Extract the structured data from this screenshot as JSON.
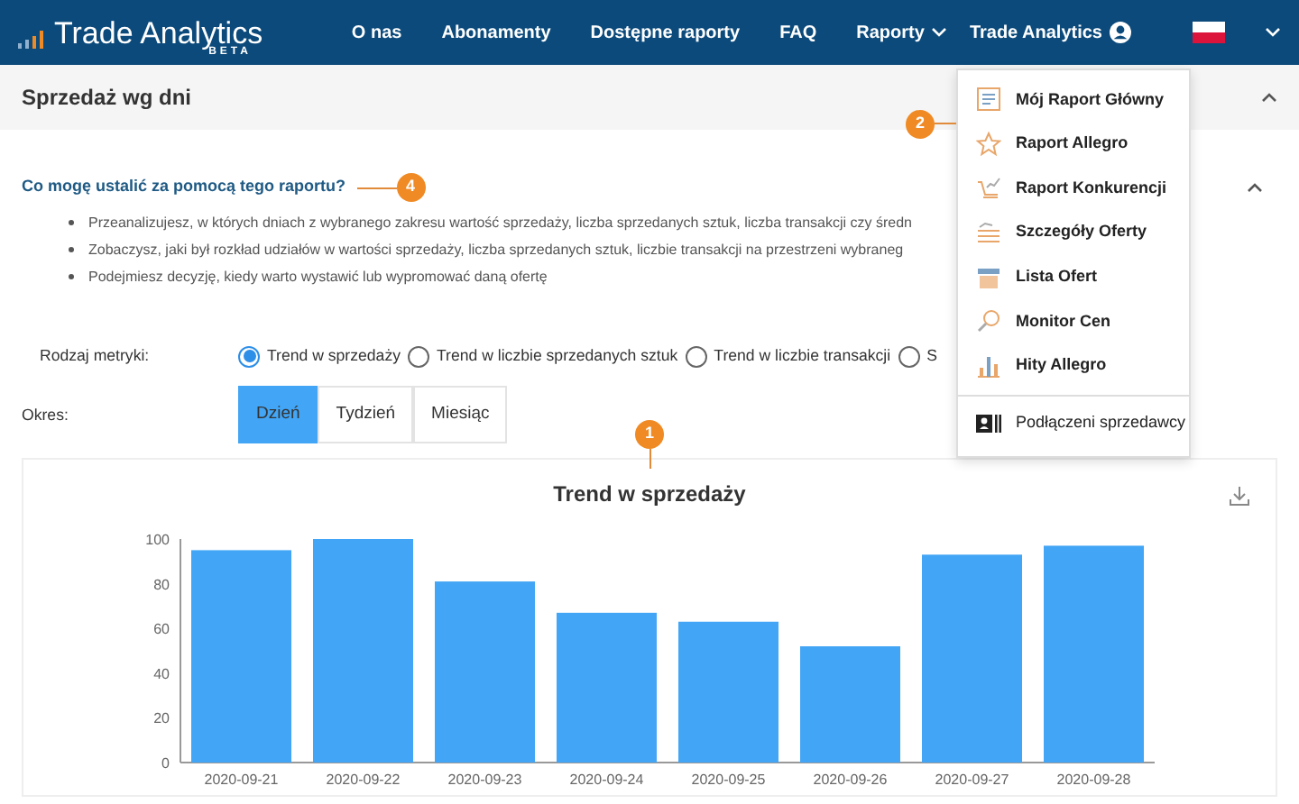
{
  "navbar": {
    "brand": "Trade Analytics",
    "brand_sub": "BETA",
    "links": [
      {
        "label": "O nas"
      },
      {
        "label": "Abonamenty"
      },
      {
        "label": "Dostępne raporty"
      },
      {
        "label": "FAQ"
      },
      {
        "label": "Raporty",
        "expanded": true
      }
    ],
    "account": "Trade Analytics"
  },
  "section": {
    "title": "Sprzedaż wg dni",
    "expanded": true
  },
  "faq": {
    "question": "Co mogę ustalić za pomocą tego raportu?",
    "expanded": true,
    "bullets": [
      "Przeanalizujesz, w których dniach z wybranego zakresu wartość sprzedaży, liczba sprzedanych sztuk, liczba transakcji czy średn",
      "Zobaczysz, jaki był rozkład udziałów w wartości sprzedaży, liczba sprzedanych sztuk, liczbie transakcji na przestrzeni wybraneg",
      "Podejmiesz decyzję, kiedy warto wystawić lub wypromować daną ofertę"
    ]
  },
  "metric": {
    "label": "Rodzaj metryki:",
    "options": [
      {
        "label": "Trend w sprzedaży",
        "selected": true
      },
      {
        "label": "Trend w liczbie sprzedanych sztuk",
        "selected": false
      },
      {
        "label": "Trend w liczbie transakcji",
        "selected": false
      },
      {
        "label": "S",
        "selected": false
      }
    ]
  },
  "period": {
    "label": "Okres:",
    "options": [
      {
        "label": "Dzień",
        "selected": true
      },
      {
        "label": "Tydzień",
        "selected": false
      },
      {
        "label": "Miesiąc",
        "selected": false
      }
    ]
  },
  "chart": {
    "chart_data": {
      "type": "bar",
      "title": "Trend w sprzedaży",
      "categories": [
        "2020-09-21",
        "2020-09-22",
        "2020-09-23",
        "2020-09-24",
        "2020-09-25",
        "2020-09-26",
        "2020-09-27",
        "2020-09-28"
      ],
      "values": [
        95,
        100,
        81,
        67,
        63,
        52,
        93,
        97
      ],
      "ylim": [
        0,
        100
      ],
      "yticks": [
        0,
        20,
        40,
        60,
        80,
        100
      ]
    }
  },
  "dropdown": {
    "items": [
      {
        "label": "Mój Raport Główny",
        "kind": "report"
      },
      {
        "label": "Raport Allegro",
        "kind": "report"
      },
      {
        "label": "Raport Konkurencji",
        "kind": "report"
      },
      {
        "label": "Szczegóły Oferty",
        "kind": "report"
      },
      {
        "label": "Lista Ofert",
        "kind": "report"
      },
      {
        "label": "Monitor Cen",
        "kind": "report"
      },
      {
        "label": "Hity Allegro",
        "kind": "report"
      },
      {
        "label": "Podłączeni sprzedawcy",
        "kind": "sellers"
      }
    ]
  },
  "callouts": [
    {
      "label": "2"
    },
    {
      "label": "4"
    },
    {
      "label": "1"
    }
  ]
}
